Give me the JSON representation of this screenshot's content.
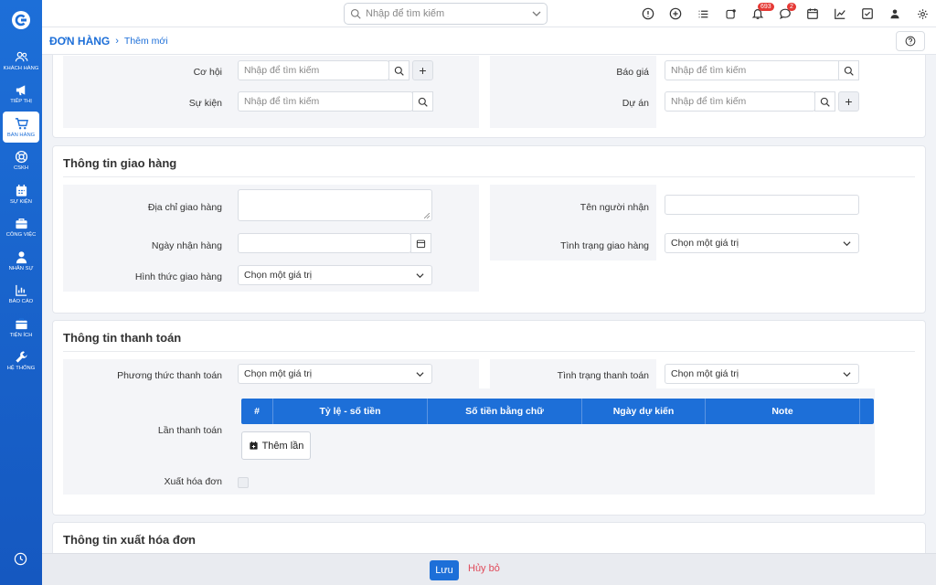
{
  "sidebar": {
    "items": [
      {
        "label": "KHÁCH HÀNG",
        "icon": "users-icon"
      },
      {
        "label": "TIẾP THỊ",
        "icon": "megaphone-icon"
      },
      {
        "label": "BÁN HÀNG",
        "icon": "cart-icon"
      },
      {
        "label": "CSKH",
        "icon": "support-icon"
      },
      {
        "label": "SỰ KIỆN",
        "icon": "calendar-icon"
      },
      {
        "label": "CÔNG VIỆC",
        "icon": "briefcase-icon"
      },
      {
        "label": "NHÂN SỰ",
        "icon": "person-icon"
      },
      {
        "label": "BÁO CÁO",
        "icon": "report-icon"
      },
      {
        "label": "TIỆN ÍCH",
        "icon": "box-icon"
      },
      {
        "label": "HỆ THỐNG",
        "icon": "wrench-icon"
      }
    ],
    "active_index": 2
  },
  "topbar": {
    "search_placeholder": "Nhập để tìm kiếm",
    "notification_count": "693",
    "message_count": "2"
  },
  "breadcrumb": {
    "main": "ĐƠN HÀNG",
    "sub": "Thêm mới"
  },
  "related": {
    "co_hoi_label": "Cơ hội",
    "co_hoi_placeholder": "Nhập để tìm kiếm",
    "su_kien_label": "Sự kiện",
    "su_kien_placeholder": "Nhập để tìm kiếm",
    "bao_gia_label": "Báo giá",
    "bao_gia_placeholder": "Nhập để tìm kiếm",
    "du_an_label": "Dự án",
    "du_an_placeholder": "Nhập để tìm kiếm"
  },
  "delivery": {
    "title": "Thông tin giao hàng",
    "address_label": "Địa chỉ giao hàng",
    "receive_date_label": "Ngày nhận hàng",
    "method_label": "Hình thức giao hàng",
    "method_value": "Chọn một giá trị",
    "recipient_label": "Tên người nhận",
    "status_label": "Tình trạng giao hàng",
    "status_value": "Chọn một giá trị"
  },
  "payment": {
    "title": "Thông tin thanh toán",
    "method_label": "Phương thức thanh toán",
    "method_value": "Chọn một giá trị",
    "status_label": "Tình trạng thanh toán",
    "status_value": "Chọn một giá trị",
    "installments_label": "Lần thanh toán",
    "table_headers": [
      "#",
      "Tỷ lệ - số tiền",
      "Số tiền bằng chữ",
      "Ngày dự kiến",
      "Note"
    ],
    "add_button": "Thêm lần",
    "invoice_label": "Xuất hóa đơn"
  },
  "invoice": {
    "title": "Thông tin xuất hóa đơn"
  },
  "footer": {
    "save": "Lưu",
    "cancel": "Hủy bỏ"
  },
  "colors": {
    "primary": "#1d6fd8",
    "danger": "#e04a5a"
  }
}
